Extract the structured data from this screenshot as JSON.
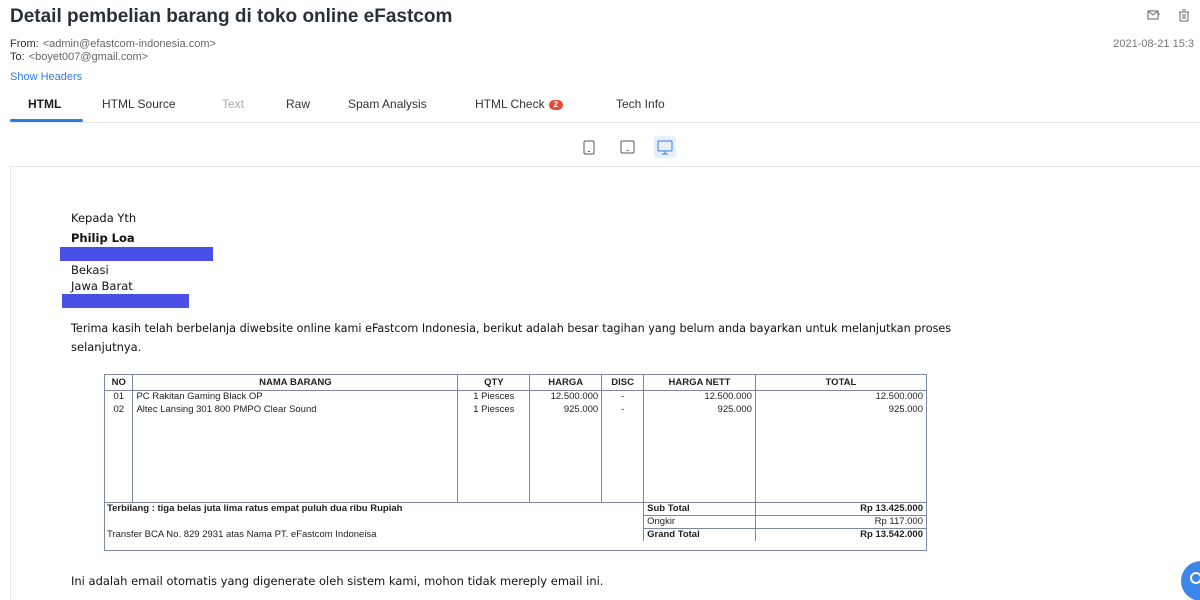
{
  "subject": "Detail pembelian barang di toko online eFastcom",
  "header": {
    "from_label": "From:",
    "from_value": "<admin@efastcom-indonesia.com>",
    "to_label": "To:",
    "to_value": "<boyet007@gmail.com>",
    "date": "2021-08-21 15:3",
    "show_headers": "Show Headers"
  },
  "icons": {
    "forward": "mail-forward-icon",
    "delete": "trash-icon",
    "devices": [
      "mobile-icon",
      "tablet-icon",
      "desktop-icon"
    ]
  },
  "tabs": [
    {
      "label": "HTML"
    },
    {
      "label": "HTML Source"
    },
    {
      "label": "Text"
    },
    {
      "label": "Raw"
    },
    {
      "label": "Spam Analysis"
    },
    {
      "label": "HTML Check",
      "badge": "2"
    },
    {
      "label": "Tech Info"
    }
  ],
  "email": {
    "greeting": "Kepada Yth",
    "name": "Philip Loa",
    "city": "Bekasi",
    "province": "Jawa Barat",
    "intro_line1": "Terima kasih telah berbelanja diwebsite online kami eFastcom Indonesia, berikut adalah besar tagihan yang belum anda bayarkan untuk melanjutkan proses",
    "intro_line2": "selanjutnya.",
    "footer": "Ini adalah email otomatis yang digenerate oleh sistem kami, mohon tidak mereply email ini."
  },
  "invoice": {
    "columns": [
      "NO",
      "NAMA BARANG",
      "QTY",
      "HARGA",
      "DISC",
      "HARGA NETT",
      "TOTAL"
    ],
    "rows": [
      {
        "no": "01",
        "name": "PC Rakitan Gaming Black OP",
        "qty": "1 Piesces",
        "price": "12.500.000",
        "disc": "-",
        "nett": "12.500.000",
        "total": "12.500.000"
      },
      {
        "no": "02",
        "name": "Altec Lansing 301 800 PMPO Clear Sound",
        "qty": "1 Piesces",
        "price": "925.000",
        "disc": "-",
        "nett": "925.000",
        "total": "925.000"
      }
    ],
    "terbilang": "Terbilang : tiga belas juta lima ratus empat puluh dua ribu Rupiah",
    "transfer": "Transfer BCA No. 829 2931 atas Nama PT. eFastcom Indoneisa",
    "subtotal_label": "Sub Total",
    "subtotal_value": "Rp 13.425.000",
    "ongkir_label": "Ongkir",
    "ongkir_value": "Rp 117.000",
    "grand_label": "Grand Total",
    "grand_value": "Rp 13.542.000"
  },
  "colors": {
    "accent": "#2f7be0",
    "badge": "#e8473a",
    "redaction": "#4a4fe8"
  }
}
